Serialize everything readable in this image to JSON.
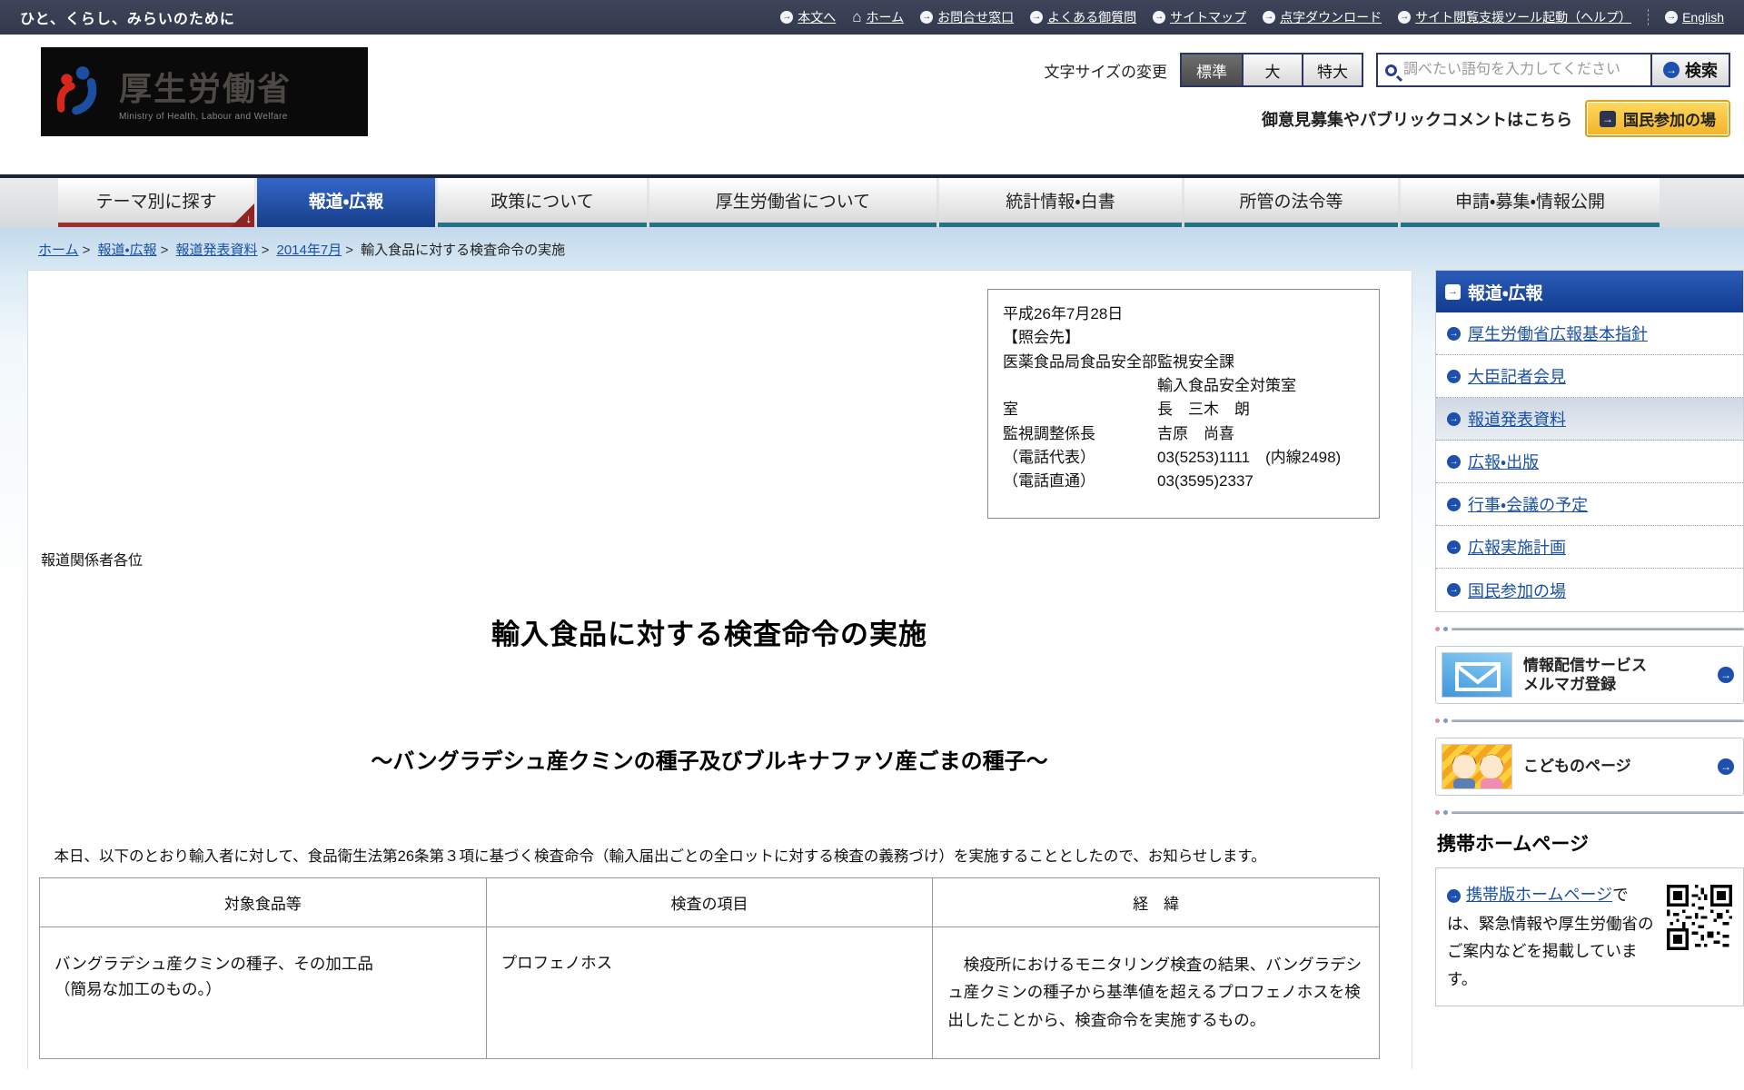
{
  "topbar": {
    "tagline": "ひと、くらし、みらいのために",
    "links": [
      {
        "label": "本文へ",
        "icon": "arrow-circle-icon"
      },
      {
        "label": "ホーム",
        "icon": "home-icon"
      },
      {
        "label": "お問合せ窓口",
        "icon": "arrow-circle-icon"
      },
      {
        "label": "よくある御質問",
        "icon": "arrow-circle-icon"
      },
      {
        "label": "サイトマップ",
        "icon": "arrow-circle-icon"
      },
      {
        "label": "点字ダウンロード",
        "icon": "arrow-circle-icon"
      },
      {
        "label": "サイト閲覧支援ツール起動（ヘルプ）",
        "icon": "arrow-circle-icon"
      },
      {
        "label": "English",
        "icon": "arrow-circle-icon"
      }
    ]
  },
  "header": {
    "logo": {
      "title": "厚生労働省",
      "subtitle": "Ministry of Health, Labour and Welfare"
    },
    "font_size": {
      "label": "文字サイズの変更",
      "options": [
        {
          "label": "標準"
        },
        {
          "label": "大"
        },
        {
          "label": "特大"
        }
      ],
      "active": "標準"
    },
    "search": {
      "placeholder": "調べたい語句を入力してください",
      "button": "検索"
    },
    "participation": {
      "text": "御意見募集やパブリックコメントはこちら",
      "button": "国民参加の場"
    }
  },
  "nav": {
    "active": "報道・広報",
    "tabs": [
      {
        "label": "テーマ別に探す"
      },
      {
        "label": "報道・広報"
      },
      {
        "label": "政策について"
      },
      {
        "label": "厚生労働省について"
      },
      {
        "label": "統計情報・白書"
      },
      {
        "label": "所管の法令等"
      },
      {
        "label": "申請・募集・情報公開"
      }
    ]
  },
  "breadcrumb": {
    "items": [
      {
        "label": "ホーム"
      },
      {
        "label": "報道・広報"
      },
      {
        "label": "報道発表資料"
      },
      {
        "label": "2014年7月"
      }
    ],
    "current": "輸入食品に対する検査命令の実施"
  },
  "main": {
    "contact": {
      "date": "平成26年7月28日",
      "heading": "【照会先】",
      "dept": "医薬食品局食品安全部監視安全課",
      "rows": [
        {
          "left": "",
          "right": "輸入食品安全対策室"
        },
        {
          "left": "室",
          "right": "長　三木　朗"
        },
        {
          "left": "監視調整係長",
          "right": "吉原　尚喜"
        },
        {
          "left": "（電話代表）",
          "right": "03(5253)1111　(内線2498)"
        },
        {
          "left": "（電話直通）",
          "right": "03(3595)2337"
        }
      ]
    },
    "salutation": "報道関係者各位",
    "title": "輸入食品に対する検査命令の実施",
    "subtitle": "～バングラデシュ産クミンの種子及びブルキナファソ産ごまの種子～",
    "body": "　本日、以下のとおり輸入者に対して、食品衛生法第26条第３項に基づく検査命令（輸入届出ごとの全ロットに対する検査の義務づけ）を実施することとしたので、お知らせします。",
    "table": {
      "headers": [
        {
          "label": "対象食品等"
        },
        {
          "label": "検査の項目"
        },
        {
          "label": "経　緯"
        }
      ],
      "row": {
        "food": "バングラデシュ産クミンの種子、その加工品\n（簡易な加工のもの。）",
        "item": "プロフェノホス",
        "background": "　検疫所におけるモニタリング検査の結果、バングラデシュ産クミンの種子から基準値を超えるプロフェノホスを検出したことから、検査命令を実施するもの。"
      }
    }
  },
  "sidebar": {
    "menu": {
      "title": "報道・広報",
      "active": "報道発表資料",
      "items": [
        {
          "label": "厚生労働省広報基本指針"
        },
        {
          "label": "大臣記者会見"
        },
        {
          "label": "報道発表資料"
        },
        {
          "label": "広報・出版"
        },
        {
          "label": "行事・会議の予定"
        },
        {
          "label": "広報実施計画"
        },
        {
          "label": "国民参加の場"
        }
      ]
    },
    "banners": [
      {
        "line1": "情報配信サービス",
        "line2": "メルマガ登録",
        "image": "envelope-sky-icon"
      },
      {
        "line1": "こどものページ",
        "line2": "",
        "image": "kids-icon"
      }
    ],
    "mobile": {
      "heading": "携帯ホームページ",
      "link": "携帯版ホームページ",
      "text": "では、緊急情報や厚生労働省のご案内などを掲載しています。",
      "qr": "qr-code-icon"
    }
  },
  "colors": {
    "topbar_bg": "#373e52",
    "nav_active_blue": "#1d4fae",
    "tab_underline_teal": "#257286",
    "tab_underline_red": "#9c2f2f",
    "link_blue": "#1a50a8",
    "participation_yellow": "#f5c132",
    "sidebar_header_blue": "#1d4fae",
    "page_band_blue": "#c3d9eb"
  }
}
